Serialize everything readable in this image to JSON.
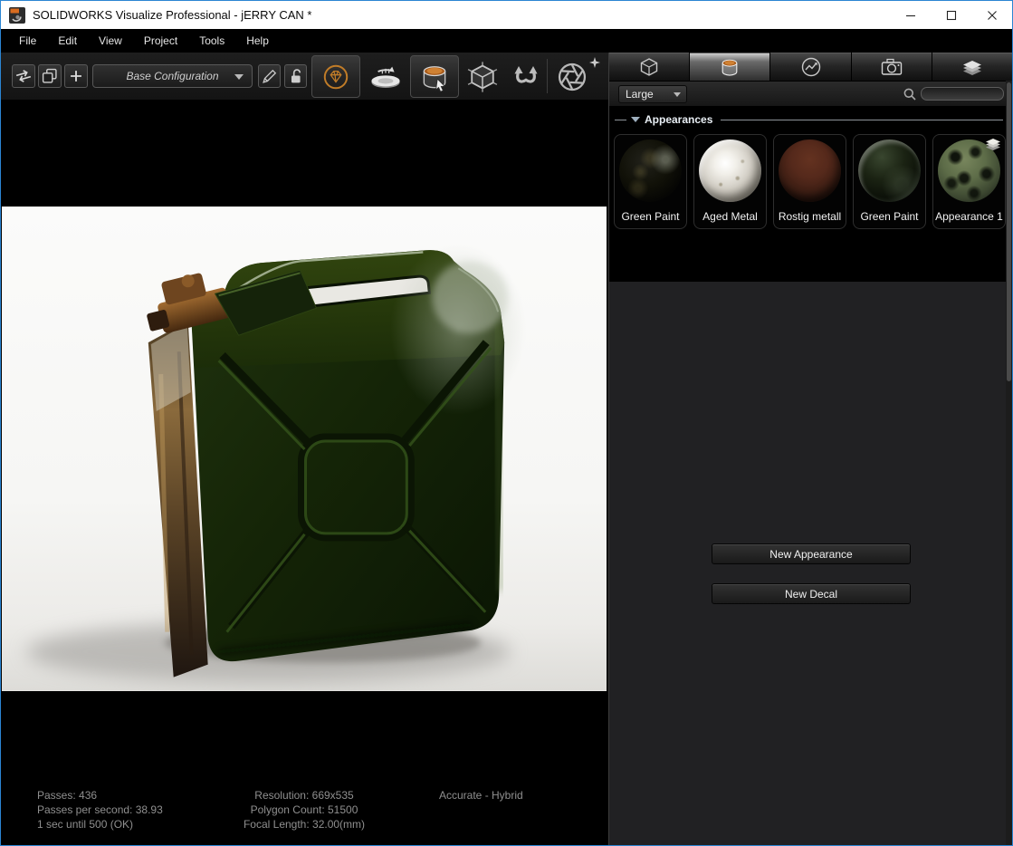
{
  "titlebar": {
    "title": "SOLIDWORKS Visualize Professional - jERRY CAN *",
    "window_controls": [
      "minimize",
      "maximize",
      "close"
    ]
  },
  "menubar": {
    "items": [
      "File",
      "Edit",
      "View",
      "Project",
      "Tools",
      "Help"
    ]
  },
  "toolbar": {
    "configuration_label": "Base Configuration",
    "icons": [
      "swap-arrows",
      "duplicate",
      "add",
      "edit-pencil",
      "lock-open",
      "render-diamond",
      "turntable",
      "paint-bucket-cursor",
      "cube-axes",
      "swap-curved",
      "aperture",
      "pin"
    ]
  },
  "panel": {
    "tabs": [
      "models-cube",
      "appearances-bucket",
      "environment-gauge",
      "cameras-camera",
      "layers-stack"
    ],
    "selected_tab_index": 1,
    "size_label": "Large",
    "search_value": "",
    "section_title": "Appearances",
    "thumbnails": [
      "Green Paint",
      "Aged Metal",
      "Rostig metall",
      "Green Paint",
      "Appearance 1"
    ],
    "new_appearance_label": "New Appearance",
    "new_decal_label": "New Decal"
  },
  "viewport_status": {
    "passes": "Passes: 436",
    "passes_per_second": "Passes per second: 38.93",
    "countdown": "1 sec until 500 (OK)",
    "resolution": "Resolution: 669x535",
    "polygon_count": "Polygon Count: 51500",
    "focal_length": "Focal Length: 32.00(mm)",
    "render_mode": "Accurate - Hybrid"
  },
  "colors": {
    "accent_orange": "#c07c28",
    "window_border": "#2b85d3",
    "panel_lower_bg": "#212123",
    "status_text": "#8f8f8f"
  }
}
